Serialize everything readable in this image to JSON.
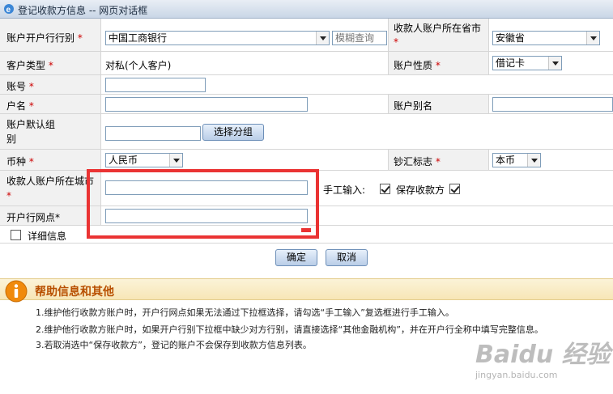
{
  "window": {
    "title": "登记收款方信息 -- 网页对话框"
  },
  "form": {
    "bank_label": "账户开户行行别",
    "bank_value": "中国工商银行",
    "fuzzy_placeholder": "模糊查询",
    "province_label": "收款人账户所在省市",
    "province_value": "安徽省",
    "customer_type_label": "客户类型",
    "customer_type_value": "对私(个人客户)",
    "account_nature_label": "账户性质",
    "account_nature_value": "借记卡",
    "account_no_label": "账号",
    "account_name_label": "户名",
    "account_alias_label": "账户别名",
    "default_group_label": "账户默认组别",
    "select_group_button": "选择分组",
    "currency_label": "币种",
    "currency_value": "人民币",
    "cash_flag_label": "钞汇标志",
    "cash_flag_value": "本币",
    "city_label": "收款人账户所在城市",
    "manual_input_label": "手工输入:",
    "save_payee_label": "保存收款方",
    "branch_label": "开户行网点*",
    "details_label": "详细信息",
    "required_mark": "*"
  },
  "buttons": {
    "ok": "确定",
    "cancel": "取消"
  },
  "help": {
    "title": "帮助信息和其他",
    "lines": [
      "1.维护他行收款方账户时，开户行网点如果无法通过下拉框选择，请勾选“手工输入”复选框进行手工输入。",
      "2.维护他行收款方账户时，如果开户行别下拉框中缺少对方行别，请直接选择“其他金融机构”，并在开户行全称中填写完整信息。",
      "3.若取消选中“保存收款方”，登记的账户不会保存到收款方信息列表。"
    ]
  },
  "watermark": {
    "brand": "Baidu 经验",
    "url": "jingyan.baidu.com"
  },
  "colors": {
    "highlight": "#ea3333",
    "help_title": "#b84f00",
    "required": "#cc0000"
  }
}
